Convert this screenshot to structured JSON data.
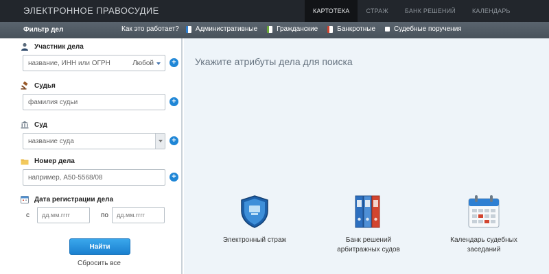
{
  "header": {
    "brand": "ЭЛЕКТРОННОЕ ПРАВОСУДИЕ",
    "nav": [
      {
        "label": "КАРТОТЕКА",
        "active": true
      },
      {
        "label": "СТРАЖ",
        "active": false
      },
      {
        "label": "БАНК РЕШЕНИЙ",
        "active": false
      },
      {
        "label": "КАЛЕНДАРЬ",
        "active": false
      }
    ]
  },
  "filterbar": {
    "title": "Фильтр дел",
    "how_it_works": "Как это работает?",
    "types": [
      {
        "label": "Административные",
        "icon": "admin-case-icon",
        "color": "#2f7fd0"
      },
      {
        "label": "Гражданские",
        "icon": "civil-case-icon",
        "color": "#6aa83a"
      },
      {
        "label": "Банкротные",
        "icon": "bankruptcy-case-icon",
        "color": "#d0432f"
      },
      {
        "label": "Судебные поручения",
        "icon": "court-order-icon",
        "color": "#ffffff"
      }
    ]
  },
  "sidebar": {
    "participant": {
      "label": "Участник дела",
      "placeholder": "название, ИНН или ОГРН",
      "mode": "Любой"
    },
    "judge": {
      "label": "Судья",
      "placeholder": "фамилия судьи"
    },
    "court": {
      "label": "Суд",
      "placeholder": "название суда"
    },
    "case_number": {
      "label": "Номер дела",
      "placeholder": "например, А50-5568/08"
    },
    "registration_date": {
      "label": "Дата регистрации дела",
      "from_label": "с",
      "to_label": "по",
      "from_placeholder": "дд.мм.гггг",
      "to_placeholder": "дд.мм.гггг"
    },
    "find_button": "Найти",
    "reset_link": "Сбросить все"
  },
  "main": {
    "hint": "Укажите атрибуты дела для поиска",
    "promos": [
      {
        "line1": "Электронный страж",
        "line2": "",
        "icon": "shield-icon"
      },
      {
        "line1": "Банк решений",
        "line2": "арбитражных судов",
        "icon": "binders-icon"
      },
      {
        "line1": "Календарь судебных",
        "line2": "заседаний",
        "icon": "calendar-icon"
      }
    ]
  },
  "colors": {
    "accent": "#1f86d6",
    "topbar": "#22262c",
    "main_bg": "#eef4f9"
  }
}
